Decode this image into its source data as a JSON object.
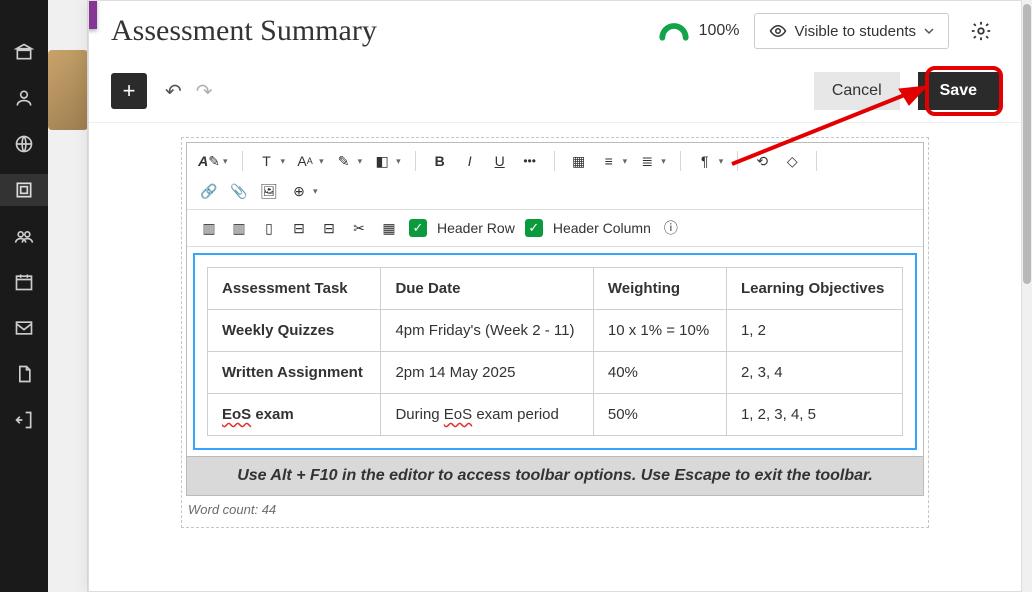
{
  "header": {
    "title": "Assessment Summary",
    "progress_pct": "100%",
    "visibility_label": "Visible to students"
  },
  "actions": {
    "add_label": "+",
    "undo_icon": "↶",
    "redo_icon": "↷",
    "cancel_label": "Cancel",
    "save_label": "Save"
  },
  "toolbar": {
    "header_row_label": "Header Row",
    "header_col_label": "Header Column"
  },
  "editor": {
    "hint": "Use Alt + F10 in the editor to access toolbar options. Use Escape to exit the toolbar.",
    "word_count": "Word count: 44",
    "table": {
      "headers": [
        "Assessment Task",
        "Due Date",
        "Weighting",
        "Learning Objectives"
      ],
      "rows": [
        {
          "task": "Weekly Quizzes",
          "due": "4pm Friday's (Week 2 - 11)",
          "weighting": "10 x 1% = 10%",
          "lo": "1, 2"
        },
        {
          "task": "Written Assignment",
          "due": "2pm 14 May 2025",
          "weighting": "40%",
          "lo": "2, 3, 4"
        },
        {
          "task": "EoS exam",
          "task_pre": "",
          "task_squiggle": "EoS",
          "task_post": " exam",
          "due": "During EoS exam period",
          "due_pre": "During ",
          "due_squiggle": "EoS",
          "due_post": " exam period",
          "weighting": "50%",
          "lo": "1, 2, 3, 4, 5"
        }
      ]
    }
  },
  "close_icon": "✕"
}
